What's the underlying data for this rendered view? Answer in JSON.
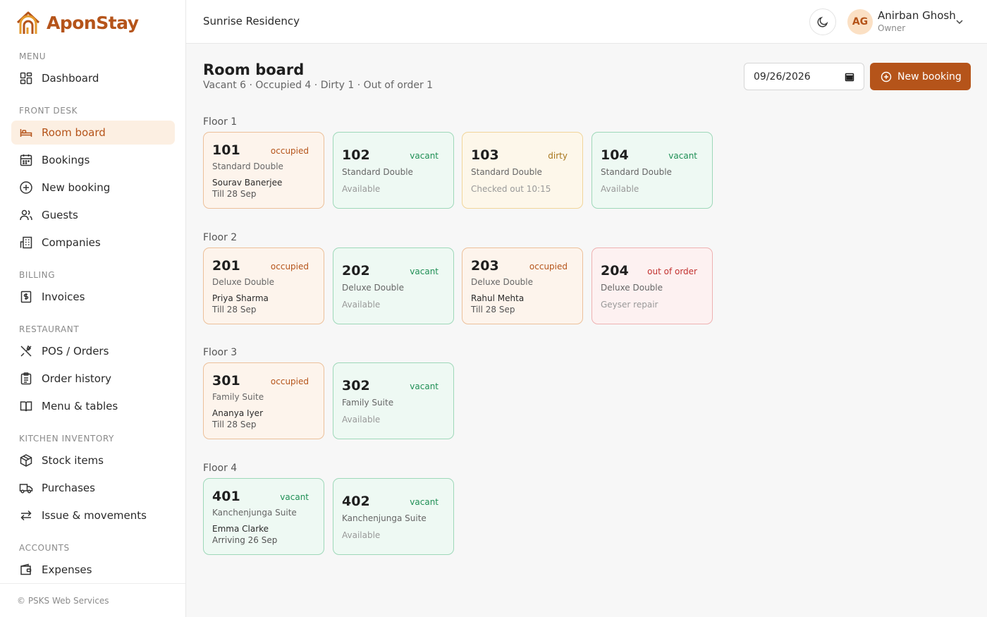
{
  "brand": {
    "name": "AponStay",
    "color": "#b5541a"
  },
  "sidebar": {
    "sections": [
      {
        "title": "MENU",
        "items": [
          {
            "label": "Dashboard",
            "icon": "dashboard-icon"
          }
        ]
      },
      {
        "title": "FRONT DESK",
        "items": [
          {
            "label": "Room board",
            "icon": "bed-icon",
            "active": true
          },
          {
            "label": "Bookings",
            "icon": "calendar-icon"
          },
          {
            "label": "New booking",
            "icon": "plus-circle-icon"
          },
          {
            "label": "Guests",
            "icon": "users-icon"
          },
          {
            "label": "Companies",
            "icon": "building-icon"
          }
        ]
      },
      {
        "title": "BILLING",
        "items": [
          {
            "label": "Invoices",
            "icon": "invoice-icon"
          }
        ]
      },
      {
        "title": "RESTAURANT",
        "items": [
          {
            "label": "POS / Orders",
            "icon": "utensils-icon"
          },
          {
            "label": "Order history",
            "icon": "clipboard-icon"
          },
          {
            "label": "Menu & tables",
            "icon": "book-icon"
          }
        ]
      },
      {
        "title": "KITCHEN INVENTORY",
        "items": [
          {
            "label": "Stock items",
            "icon": "package-icon"
          },
          {
            "label": "Purchases",
            "icon": "truck-icon"
          },
          {
            "label": "Issue & movements",
            "icon": "arrows-icon"
          }
        ]
      },
      {
        "title": "ACCOUNTS",
        "items": [
          {
            "label": "Expenses",
            "icon": "wallet-icon"
          }
        ]
      }
    ],
    "footer": "© PSKS Web Services"
  },
  "header": {
    "property": "Sunrise Residency",
    "user": {
      "initials": "AG",
      "name": "Anirban Ghosh",
      "role": "Owner"
    }
  },
  "main": {
    "title": "Room board",
    "summary": "Vacant 6 · Occupied 4 · Dirty 1 · Out of order 1",
    "date": "09/26/2026",
    "new_booking_label": "New booking",
    "floors": [
      {
        "label": "Floor 1",
        "rooms": [
          {
            "number": "101",
            "status": "occupied",
            "type": "Standard Double",
            "line1": "Sourav Banerjee",
            "line2": "Till 28 Sep"
          },
          {
            "number": "102",
            "status": "vacant",
            "type": "Standard Double",
            "note": "Available"
          },
          {
            "number": "103",
            "status": "dirty",
            "type": "Standard Double",
            "note": "Checked out 10:15"
          },
          {
            "number": "104",
            "status": "vacant",
            "type": "Standard Double",
            "note": "Available"
          }
        ]
      },
      {
        "label": "Floor 2",
        "rooms": [
          {
            "number": "201",
            "status": "occupied",
            "type": "Deluxe Double",
            "line1": "Priya Sharma",
            "line2": "Till 28 Sep"
          },
          {
            "number": "202",
            "status": "vacant",
            "type": "Deluxe Double",
            "note": "Available"
          },
          {
            "number": "203",
            "status": "occupied",
            "type": "Deluxe Double",
            "line1": "Rahul Mehta",
            "line2": "Till 28 Sep"
          },
          {
            "number": "204",
            "status": "out of order",
            "type": "Deluxe Double",
            "note": "Geyser repair"
          }
        ]
      },
      {
        "label": "Floor 3",
        "rooms": [
          {
            "number": "301",
            "status": "occupied",
            "type": "Family Suite",
            "line1": "Ananya Iyer",
            "line2": "Till 28 Sep"
          },
          {
            "number": "302",
            "status": "vacant",
            "type": "Family Suite",
            "note": "Available"
          }
        ]
      },
      {
        "label": "Floor 4",
        "rooms": [
          {
            "number": "401",
            "status": "vacant",
            "type": "Kanchenjunga Suite",
            "line1": "Emma Clarke",
            "line2": "Arriving 26 Sep"
          },
          {
            "number": "402",
            "status": "vacant",
            "type": "Kanchenjunga Suite",
            "note": "Available"
          }
        ]
      }
    ]
  }
}
